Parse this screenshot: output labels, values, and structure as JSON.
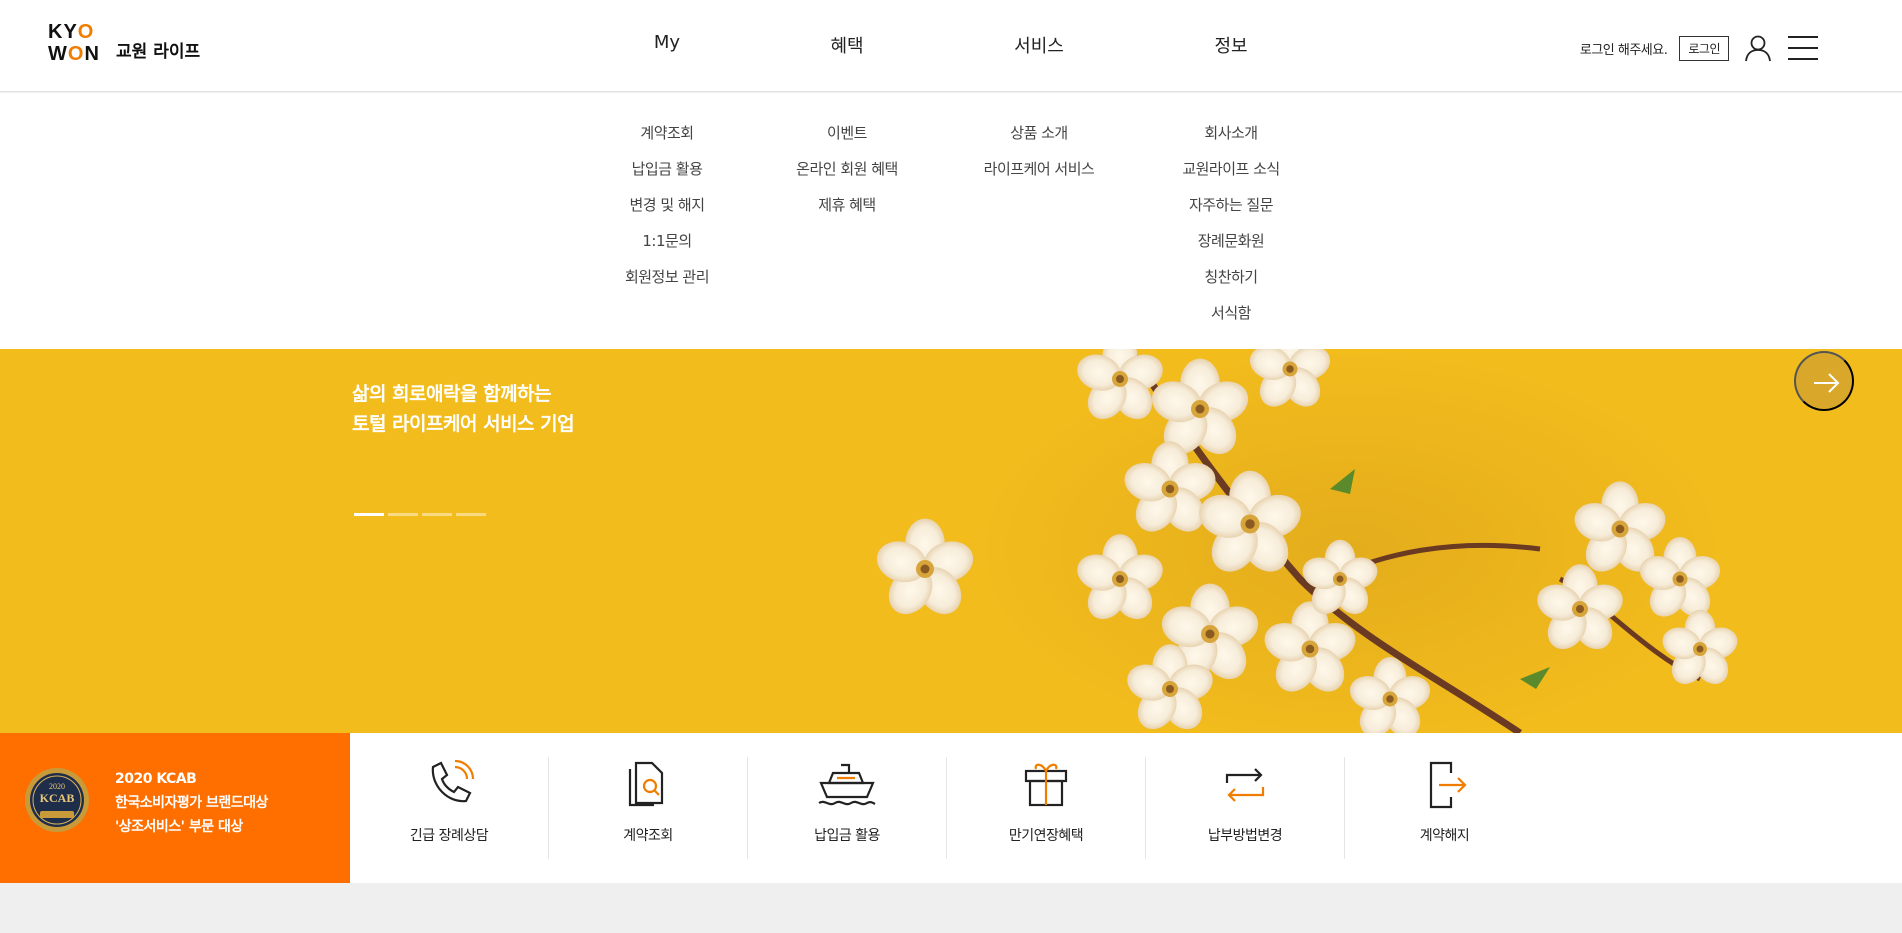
{
  "brand": {
    "logo_line1": "KYO",
    "logo_line2": "WON",
    "name": "교원 라이프"
  },
  "gnb": [
    {
      "label": "My"
    },
    {
      "label": "혜택"
    },
    {
      "label": "서비스"
    },
    {
      "label": "정보"
    }
  ],
  "util": {
    "greeting": "로그인 해주세요.",
    "login_label": "로그인",
    "user_icon": "user-icon",
    "menu_icon": "hamburger-menu-icon"
  },
  "dropdown": {
    "my": [
      "계약조회",
      "납입금 활용",
      "변경 및 해지",
      "1:1문의",
      "회원정보 관리"
    ],
    "benefits": [
      "이벤트",
      "온라인 회원 혜택",
      "제휴 혜택"
    ],
    "services": [
      "상품 소개",
      "라이프케어 서비스"
    ],
    "info": [
      "회사소개",
      "교원라이프 소식",
      "자주하는 질문",
      "장례문화원",
      "칭찬하기",
      "서식함"
    ]
  },
  "hero": {
    "line1": "삶의 희로애락을 함께하는",
    "line2": "토털 라이프케어 서비스 기업",
    "slides": 4,
    "active_slide": 1,
    "next_icon": "arrow-right-icon",
    "colors": {
      "background": "#f2bc1d",
      "next_button": "#d9a82a"
    }
  },
  "award": {
    "line1": "2020 KCAB",
    "line2": "한국소비자평가 브랜드대상",
    "line3": "'상조서비스' 부문 대상",
    "badge_year": "2020",
    "badge_title": "KCAB",
    "color": "#ff6f00"
  },
  "quick_menu": [
    {
      "label": "긴급 장례상담",
      "icon": "phone-icon"
    },
    {
      "label": "계약조회",
      "icon": "document-search-icon"
    },
    {
      "label": "납입금 활용",
      "icon": "cruise-ship-icon"
    },
    {
      "label": "만기연장혜택",
      "icon": "gift-box-icon"
    },
    {
      "label": "납부방법변경",
      "icon": "exchange-arrows-icon"
    },
    {
      "label": "계약해지",
      "icon": "exit-icon"
    }
  ],
  "colors": {
    "accent": "#f07d00",
    "orange": "#ff6f00"
  }
}
